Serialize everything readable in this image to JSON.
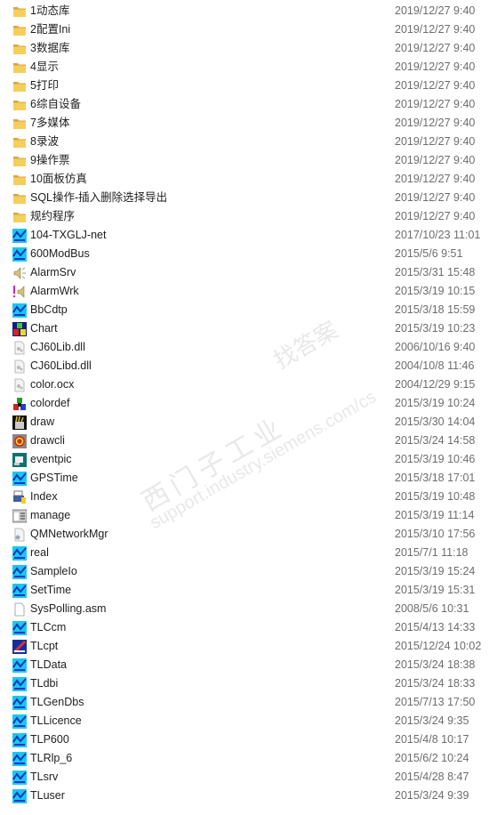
{
  "files": [
    {
      "name": "1动态库",
      "date": "2019/12/27 9:40",
      "icon": "folder"
    },
    {
      "name": "2配置Ini",
      "date": "2019/12/27 9:40",
      "icon": "folder"
    },
    {
      "name": "3数据库",
      "date": "2019/12/27 9:40",
      "icon": "folder"
    },
    {
      "name": "4显示",
      "date": "2019/12/27 9:40",
      "icon": "folder"
    },
    {
      "name": "5打印",
      "date": "2019/12/27 9:40",
      "icon": "folder"
    },
    {
      "name": "6综自设备",
      "date": "2019/12/27 9:40",
      "icon": "folder"
    },
    {
      "name": "7多媒体",
      "date": "2019/12/27 9:40",
      "icon": "folder"
    },
    {
      "name": "8录波",
      "date": "2019/12/27 9:40",
      "icon": "folder"
    },
    {
      "name": "9操作票",
      "date": "2019/12/27 9:40",
      "icon": "folder"
    },
    {
      "name": "10面板仿真",
      "date": "2019/12/27 9:40",
      "icon": "folder"
    },
    {
      "name": "SQL操作-插入删除选择导出",
      "date": "2019/12/27 9:40",
      "icon": "folder"
    },
    {
      "name": "规约程序",
      "date": "2019/12/27 9:40",
      "icon": "folder"
    },
    {
      "name": "104-TXGLJ-net",
      "date": "2017/10/23 11:01",
      "icon": "app-wave"
    },
    {
      "name": "600ModBus",
      "date": "2015/5/6 9:51",
      "icon": "app-wave"
    },
    {
      "name": "AlarmSrv",
      "date": "2015/3/31 15:48",
      "icon": "speaker"
    },
    {
      "name": "AlarmWrk",
      "date": "2015/3/19 10:15",
      "icon": "alarm-speaker"
    },
    {
      "name": "BbCdtp",
      "date": "2015/3/18 15:59",
      "icon": "app-wave"
    },
    {
      "name": "Chart",
      "date": "2015/3/19 10:23",
      "icon": "cubes"
    },
    {
      "name": "CJ60Lib.dll",
      "date": "2006/10/16 9:40",
      "icon": "dll"
    },
    {
      "name": "CJ60Libd.dll",
      "date": "2004/10/8 11:46",
      "icon": "dll"
    },
    {
      "name": "color.ocx",
      "date": "2004/12/29 9:15",
      "icon": "dll"
    },
    {
      "name": "colordef",
      "date": "2015/3/19 10:24",
      "icon": "color-cubes"
    },
    {
      "name": "draw",
      "date": "2015/3/30 14:04",
      "icon": "pencils"
    },
    {
      "name": "drawcli",
      "date": "2015/3/24 14:58",
      "icon": "drawcli"
    },
    {
      "name": "eventpic",
      "date": "2015/3/19 10:46",
      "icon": "eventpic"
    },
    {
      "name": "GPSTime",
      "date": "2015/3/18 17:01",
      "icon": "app-wave"
    },
    {
      "name": "Index",
      "date": "2015/3/19 10:48",
      "icon": "printer"
    },
    {
      "name": "manage",
      "date": "2015/3/19 11:14",
      "icon": "manage"
    },
    {
      "name": "QMNetworkMgr",
      "date": "2015/3/10 17:56",
      "icon": "gear-file"
    },
    {
      "name": "real",
      "date": "2015/7/1 11:18",
      "icon": "app-wave"
    },
    {
      "name": "SampleIo",
      "date": "2015/3/19 15:24",
      "icon": "app-wave"
    },
    {
      "name": "SetTime",
      "date": "2015/3/19 15:31",
      "icon": "app-wave"
    },
    {
      "name": "SysPolling.asm",
      "date": "2008/5/6 10:31",
      "icon": "blank-file"
    },
    {
      "name": "TLCcm",
      "date": "2015/4/13 14:33",
      "icon": "app-wave"
    },
    {
      "name": "TLcpt",
      "date": "2015/12/24 10:02",
      "icon": "tlcpt"
    },
    {
      "name": "TLData",
      "date": "2015/3/24 18:38",
      "icon": "app-wave"
    },
    {
      "name": "TLdbi",
      "date": "2015/3/24 18:33",
      "icon": "app-wave"
    },
    {
      "name": "TLGenDbs",
      "date": "2015/7/13 17:50",
      "icon": "app-wave"
    },
    {
      "name": "TLLicence",
      "date": "2015/3/24 9:35",
      "icon": "app-wave"
    },
    {
      "name": "TLP600",
      "date": "2015/4/8 10:17",
      "icon": "app-wave"
    },
    {
      "name": "TLRlp_6",
      "date": "2015/6/2 10:24",
      "icon": "app-wave"
    },
    {
      "name": "TLsrv",
      "date": "2015/4/28 8:47",
      "icon": "app-wave"
    },
    {
      "name": "TLuser",
      "date": "2015/3/24 9:39",
      "icon": "app-wave"
    }
  ],
  "watermark": {
    "line1": "西门子工业",
    "line2": "找答案",
    "line3": "support.industry.siemens.com/cs"
  },
  "colors": {
    "folder": "#f0c24a",
    "app": "#18c8f0",
    "name_text": "#1e1e1e",
    "date_text": "#6d6d6d"
  }
}
